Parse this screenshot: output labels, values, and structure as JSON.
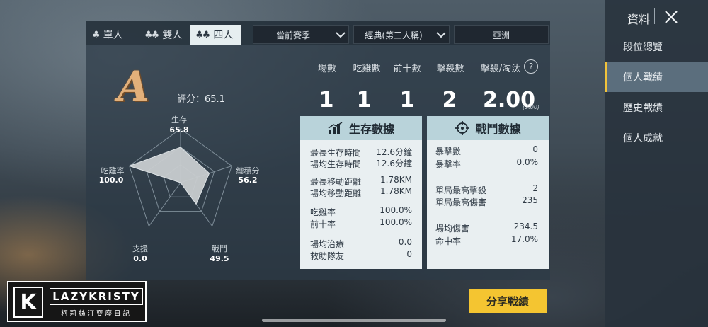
{
  "mode_tabs": [
    {
      "label": "單人",
      "icon": "single-person-icon"
    },
    {
      "label": "雙人",
      "icon": "duo-icon"
    },
    {
      "label": "四人",
      "icon": "squad-icon",
      "active": true
    }
  ],
  "filters": {
    "season": "當前賽季",
    "perspective": "經典(第三人稱)",
    "region": "亞洲"
  },
  "grade": "A",
  "score": "評分：65.1",
  "summary": {
    "headers": [
      "場數",
      "吃雞數",
      "前十數",
      "擊殺數",
      "擊殺/淘汰"
    ],
    "values": [
      "1",
      "1",
      "1",
      "2",
      "2.00"
    ],
    "kd_sub": "(2.00)"
  },
  "radar": {
    "axes": [
      {
        "label": "生存",
        "value": "65.8",
        "score": 65.8
      },
      {
        "label": "總積分",
        "value": "56.2",
        "score": 56.2
      },
      {
        "label": "戰鬥",
        "value": "49.5",
        "score": 49.5
      },
      {
        "label": "支援",
        "value": "0.0",
        "score": 0.0
      },
      {
        "label": "吃雞率",
        "value": "100.0",
        "score": 100.0
      }
    ]
  },
  "survival": {
    "title": "生存數據",
    "icon": "bar-chart-icon",
    "rows": [
      {
        "label": "最長生存時間",
        "value": "12.6分鐘"
      },
      {
        "label": "場均生存時間",
        "value": "12.6分鐘"
      },
      {
        "label": "最長移動距離",
        "value": "1.78KM"
      },
      {
        "label": "場均移動距離",
        "value": "1.78KM"
      },
      {
        "label": "吃雞率",
        "value": "100.0%"
      },
      {
        "label": "前十率",
        "value": "100.0%"
      },
      {
        "label": "場均治療",
        "value": "0.0"
      },
      {
        "label": "救助隊友",
        "value": "0"
      }
    ]
  },
  "combat": {
    "title": "戰鬥數據",
    "icon": "crosshair-icon",
    "rows": [
      {
        "label": "暴擊數",
        "value": "0"
      },
      {
        "label": "暴擊率",
        "value": "0.0%"
      },
      {
        "label": "單局最高擊殺",
        "value": "2"
      },
      {
        "label": "單局最高傷害",
        "value": "235"
      },
      {
        "label": "場均傷害",
        "value": "234.5"
      },
      {
        "label": "命中率",
        "value": "17.0%"
      }
    ]
  },
  "sidebar": {
    "title": "資料",
    "items": [
      "段位總覽",
      "個人戰績",
      "歷史戰績",
      "個人成就"
    ],
    "active_index": 1
  },
  "share_button": "分享戰績",
  "watermark": {
    "logo_letter": "K",
    "name": "LAZYKRISTY",
    "tagline": "柯莉絲汀耍廢日記"
  },
  "colors": {
    "accent_yellow": "#f4c531",
    "grade_gold": "#e2b07a",
    "card_header": "#b9d3da"
  }
}
